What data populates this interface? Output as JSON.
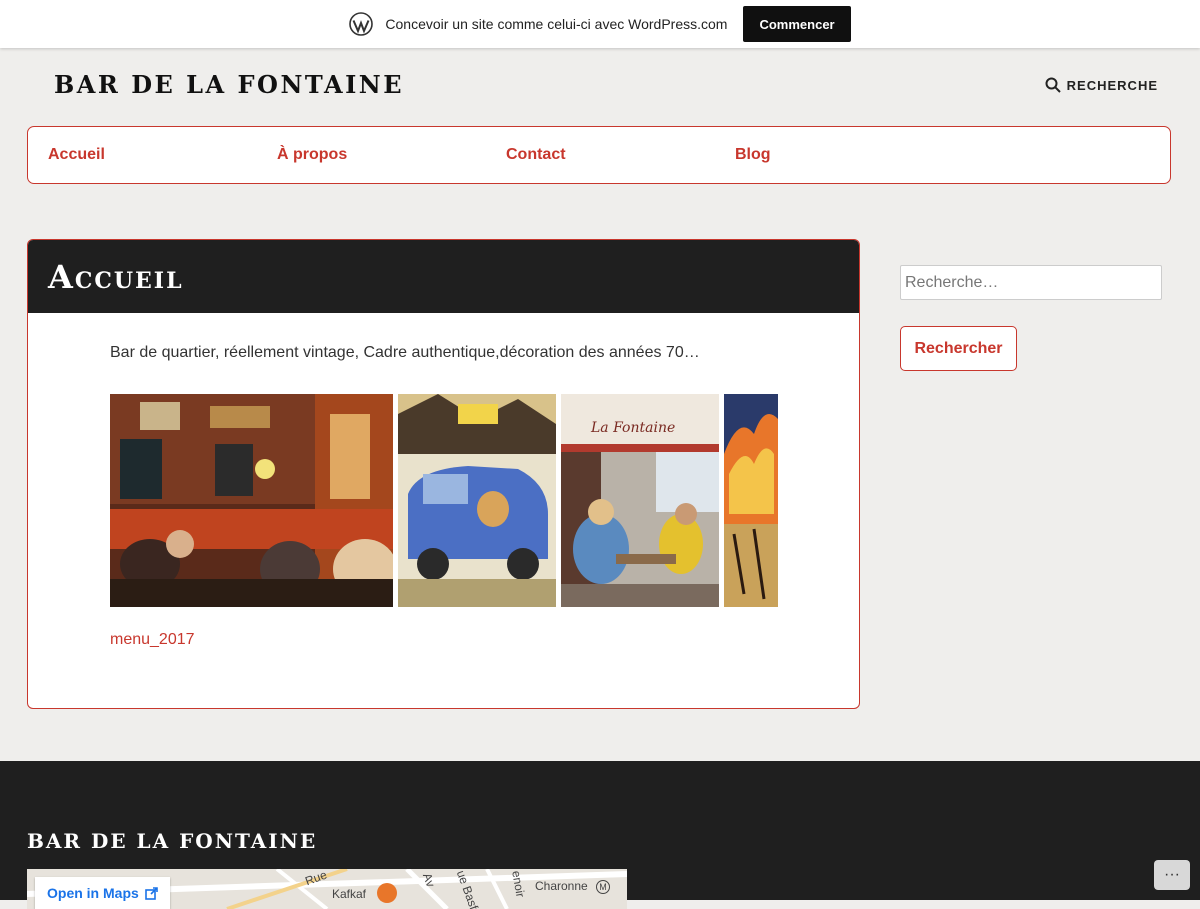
{
  "banner": {
    "logo_icon": "wordpress-logo-icon",
    "text": "Concevoir un site comme celui-ci avec WordPress.com",
    "cta_label": "Commencer"
  },
  "header": {
    "site_title": "BAR DE LA FONTAINE",
    "search_label": "RECHERCHE",
    "search_icon": "search-icon"
  },
  "nav": {
    "items": [
      {
        "label": "Accueil"
      },
      {
        "label": "À propos"
      },
      {
        "label": "Contact"
      },
      {
        "label": "Blog"
      }
    ]
  },
  "article": {
    "title": "Accueil",
    "intro": "Bar de quartier,  réellement  vintage, Cadre authentique,décoration des années 70…",
    "menu_link": "menu_2017"
  },
  "sidebar": {
    "search_placeholder": "Recherche…",
    "search_button": "Rechercher"
  },
  "footer": {
    "title": "BAR DE LA FONTAINE",
    "map_open_label": "Open in Maps",
    "map_labels": [
      "Rue",
      "Kafkaf",
      "Av",
      "ue Basf",
      "enoir",
      "Charonne"
    ]
  },
  "colors": {
    "accent": "#c8372d",
    "dark": "#1f1f1f",
    "background": "#efeeec"
  },
  "more_button_label": "···"
}
